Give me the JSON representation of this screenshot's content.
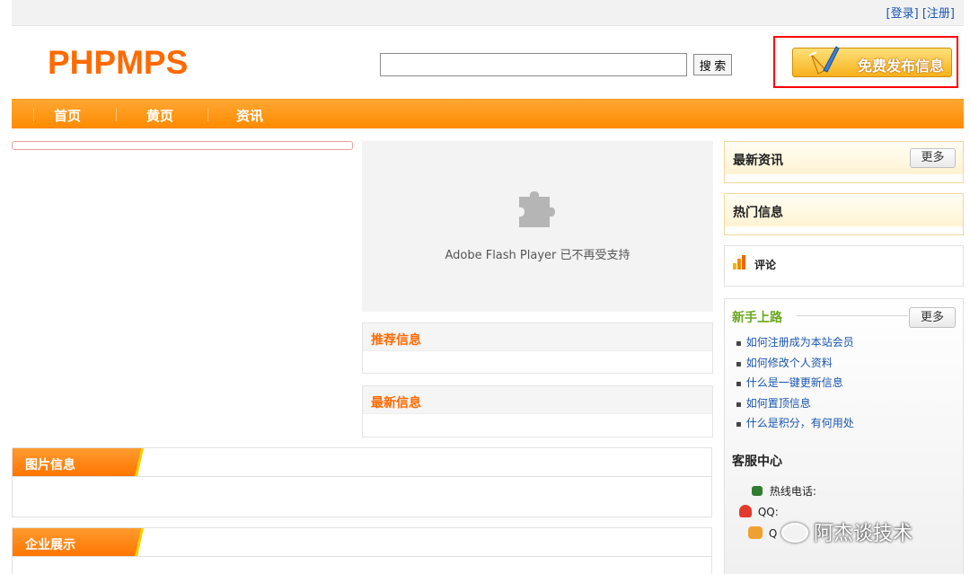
{
  "header": {
    "login_label": "[登录]",
    "register_label": "[注册]",
    "logo_text": "PHPMPS",
    "search_placeholder": "",
    "search_button_label": "搜 索",
    "publish_button_label": "免费发布信息"
  },
  "nav": {
    "items": [
      {
        "label": "首页"
      },
      {
        "label": "黄页"
      },
      {
        "label": "资讯"
      }
    ]
  },
  "main": {
    "flash_message": "Adobe Flash Player 已不再受支持",
    "recommended_title": "推荐信息",
    "latest_title": "最新信息"
  },
  "sections": {
    "pictures_title": "图片信息",
    "companies_title": "企业展示"
  },
  "sidebar": {
    "latest_news_title": "最新资讯",
    "latest_news_more": "更多",
    "hot_info_title": "热门信息",
    "comments_label": "评论",
    "newbie_title": "新手上路",
    "newbie_more": "更多",
    "help_links": [
      "如何注册成为本站会员",
      "如何修改个人资料",
      "什么是一键更新信息",
      "如何置顶信息",
      "什么是积分，有何用处"
    ],
    "service_title": "客服中心",
    "hotline_label": "热线电话:",
    "qq_label": "QQ:",
    "qq2_label": "Q"
  },
  "watermark": "阿杰谈技术",
  "colors": {
    "brand_orange": "#ff6a00",
    "nav_orange": "#ff8a00",
    "link_blue": "#1a56b0",
    "highlight_red": "#ff0000",
    "newbie_green": "#6aa820"
  }
}
